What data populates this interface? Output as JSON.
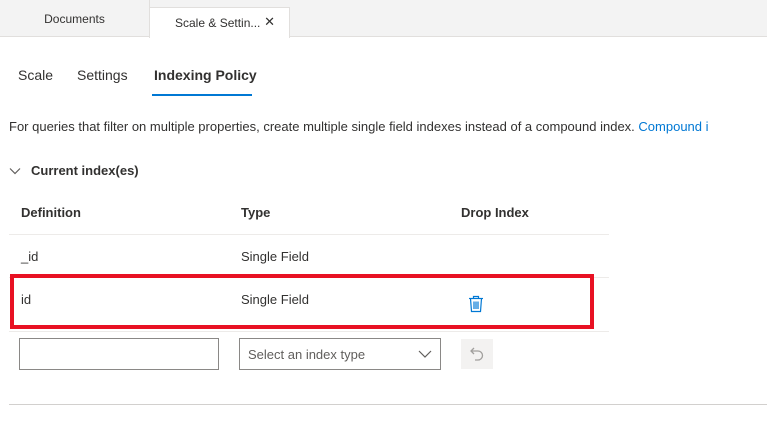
{
  "tabs": {
    "documents_label": "Documents",
    "active_label": "Scale & Settin...",
    "close_glyph": "✕"
  },
  "subtabs": [
    {
      "label": "Scale"
    },
    {
      "label": "Settings"
    },
    {
      "label": "Indexing Policy",
      "active": true
    }
  ],
  "info": {
    "text": "For queries that filter on multiple properties, create multiple single field indexes instead of a compound index. ",
    "link": "Compound i"
  },
  "section": {
    "title": "Current index(es)",
    "expanded": true
  },
  "table": {
    "headers": [
      "Definition",
      "Type",
      "Drop Index"
    ],
    "rows": [
      {
        "definition": "_id",
        "type": "Single Field",
        "droppable": false
      },
      {
        "definition": "id",
        "type": "Single Field",
        "droppable": true
      }
    ]
  },
  "new_index": {
    "definition_value": "",
    "type_placeholder": "Select an index type"
  },
  "icons": {
    "trash": "trash-icon",
    "undo": "undo-icon",
    "chevron_section": "chevron-down-icon",
    "chevron_select": "chevron-down-icon"
  },
  "colors": {
    "accent": "#0078d4",
    "highlight": "#e81123"
  }
}
